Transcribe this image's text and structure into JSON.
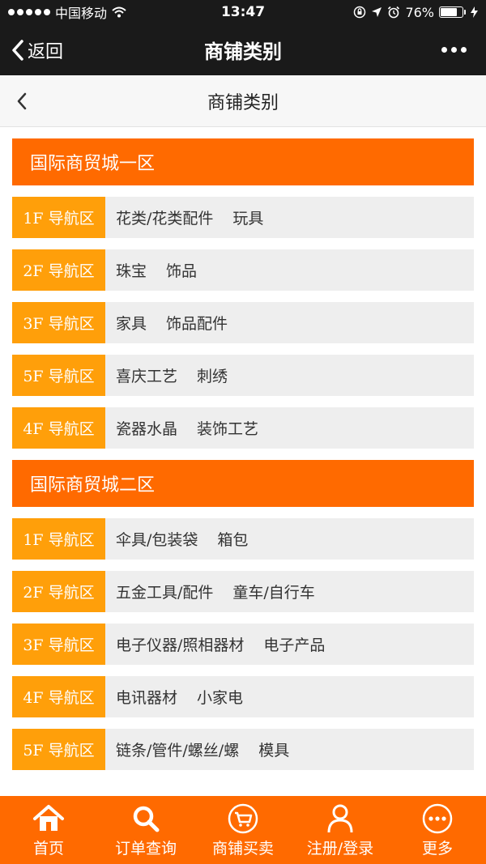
{
  "status_bar": {
    "carrier": "中国移动",
    "time": "13:47",
    "battery": "76%",
    "battery_level": 0.76
  },
  "nav": {
    "back_label": "返回",
    "title": "商铺类别"
  },
  "page": {
    "title": "商铺类别"
  },
  "sections": [
    {
      "title": "国际商贸城一区",
      "rows": [
        {
          "label": "1F 导航区",
          "items": [
            "花类/花类配件",
            "玩具"
          ]
        },
        {
          "label": "2F 导航区",
          "items": [
            "珠宝",
            "饰品"
          ]
        },
        {
          "label": "3F 导航区",
          "items": [
            "家具",
            "饰品配件"
          ]
        },
        {
          "label": "5F 导航区",
          "items": [
            "喜庆工艺",
            "刺绣"
          ]
        },
        {
          "label": "4F 导航区",
          "items": [
            "瓷器水晶",
            "装饰工艺"
          ]
        }
      ]
    },
    {
      "title": "国际商贸城二区",
      "rows": [
        {
          "label": "1F 导航区",
          "items": [
            "伞具/包装袋",
            "箱包"
          ]
        },
        {
          "label": "2F 导航区",
          "items": [
            "五金工具/配件",
            "童车/自行车"
          ]
        },
        {
          "label": "3F 导航区",
          "items": [
            "电子仪器/照相器材",
            "电子产品"
          ]
        },
        {
          "label": "4F 导航区",
          "items": [
            "电讯器材",
            "小家电"
          ]
        },
        {
          "label": "5F 导航区",
          "items": [
            "链条/管件/螺丝/螺",
            "模具"
          ]
        }
      ]
    }
  ],
  "tabs": [
    {
      "label": "首页",
      "icon": "home-icon"
    },
    {
      "label": "订单查询",
      "icon": "search-icon"
    },
    {
      "label": "商铺买卖",
      "icon": "cart-icon"
    },
    {
      "label": "注册/登录",
      "icon": "user-icon"
    },
    {
      "label": "更多",
      "icon": "more-icon"
    }
  ],
  "colors": {
    "accent": "#ff6a00",
    "row_label": "#ff9f0a",
    "row_bg": "#eeeeee",
    "bar_dark": "#1a1a1a"
  }
}
